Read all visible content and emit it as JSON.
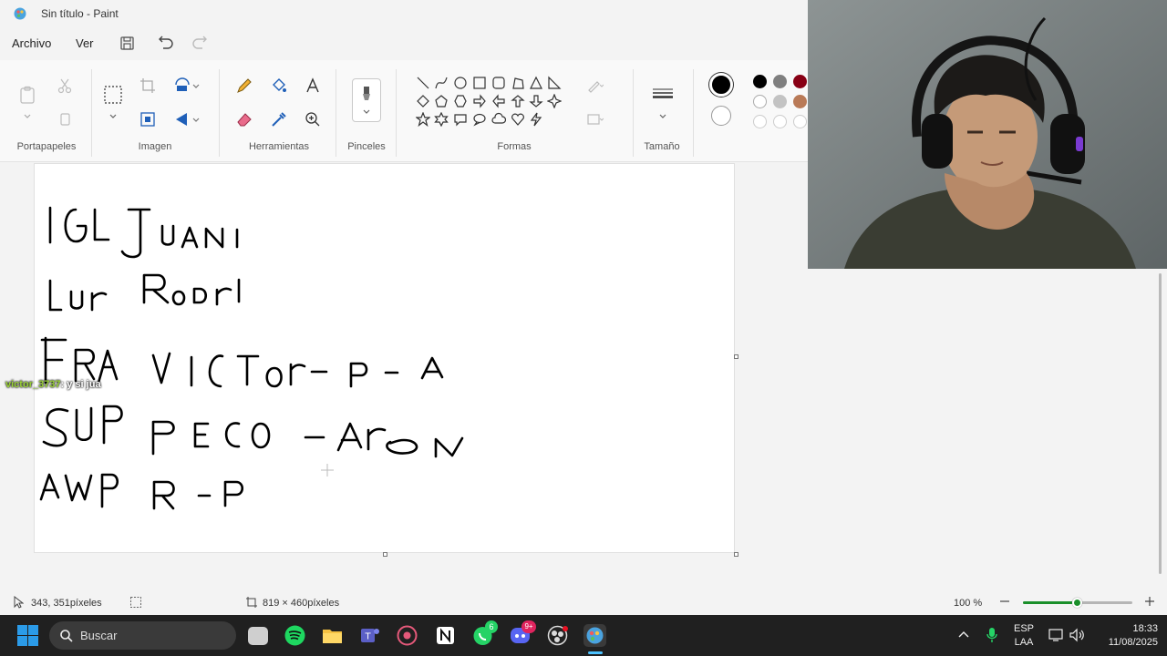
{
  "window": {
    "title": "Sin título - Paint"
  },
  "menu": {
    "file": "Archivo",
    "view": "Ver"
  },
  "ribbon": {
    "groups": {
      "clipboard": "Portapapeles",
      "image": "Imagen",
      "tools": "Herramientas",
      "brushes": "Pinceles",
      "shapes": "Formas",
      "size": "Tamaño"
    }
  },
  "colors": {
    "primary": "#000000",
    "secondary": "#ffffff",
    "palette_row1": [
      "#000000",
      "#7f7f7f",
      "#880015"
    ],
    "palette_row2": [
      "#ffffff",
      "#c3c3c3",
      "#b97a57"
    ]
  },
  "canvas_text": {
    "line1": "IGL JUAN",
    "line2": "LUR RODRI",
    "line3": "FRA VICTOR - P - A",
    "line4": "SUP PECO - ARON",
    "line5": "AWP R - P"
  },
  "chat": {
    "user": "victor_3737",
    "message": ": y si jua"
  },
  "status": {
    "cursor_pos": "343, 351píxeles",
    "canvas_size": "819 × 460píxeles",
    "zoom": "100 %",
    "zoom_value": 0.5
  },
  "taskbar": {
    "search_placeholder": "Buscar",
    "lang_top": "ESP",
    "lang_bottom": "LAA",
    "time": "18:33",
    "date": "11/08/2025",
    "whatsapp_badge": "6",
    "discord_badge": "9+"
  }
}
